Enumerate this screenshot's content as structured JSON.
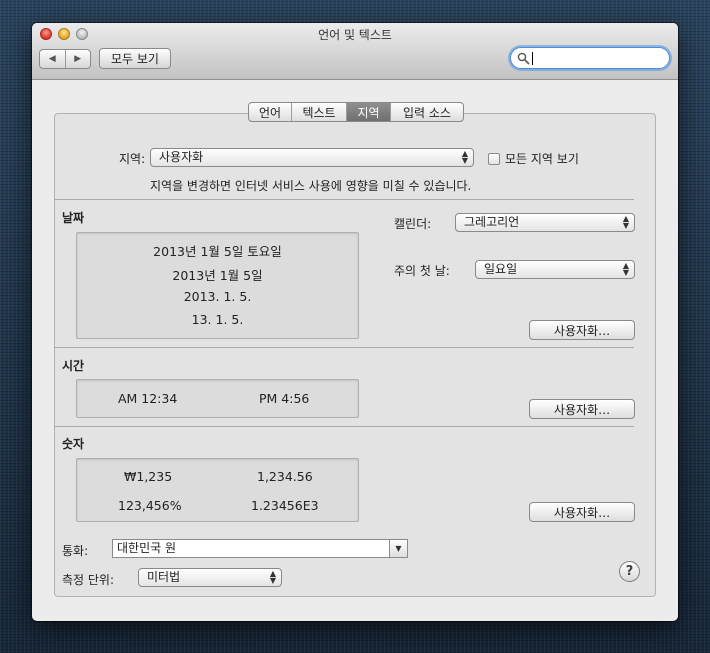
{
  "window": {
    "title": "언어 및 텍스트"
  },
  "toolbar": {
    "back_glyph": "◀",
    "forward_glyph": "▶",
    "show_all_label": "모두 보기",
    "search_value": "",
    "search_icon": "magnifier-icon"
  },
  "tabs": [
    {
      "label": "언어",
      "active": false
    },
    {
      "label": "텍스트",
      "active": false
    },
    {
      "label": "지역",
      "active": true
    },
    {
      "label": "입력 소스",
      "active": false
    }
  ],
  "region": {
    "label": "지역:",
    "value": "사용자화",
    "show_all_regions_label": "모든 지역 보기",
    "show_all_regions_checked": false,
    "note": "지역을 변경하면 인터넷 서비스 사용에 영향을 미칠 수 있습니다."
  },
  "dates": {
    "title": "날짜",
    "samples": [
      "2013년 1월 5일 토요일",
      "2013년 1월 5일",
      "2013. 1. 5.",
      "13. 1. 5."
    ],
    "calendar_label": "캘린더:",
    "calendar_value": "그레고리언",
    "first_day_label": "주의 첫 날:",
    "first_day_value": "일요일",
    "customize_label": "사용자화…"
  },
  "times": {
    "title": "시간",
    "samples": [
      "AM 12:34",
      "PM 4:56"
    ],
    "customize_label": "사용자화…"
  },
  "numbers": {
    "title": "숫자",
    "samples": [
      "₩1,235",
      "1,234.56",
      "123,456%",
      "1.23456E3"
    ],
    "customize_label": "사용자화…"
  },
  "currency": {
    "label": "통화:",
    "value": "대한민국 원"
  },
  "measurement": {
    "label": "측정 단위:",
    "value": "미터법"
  },
  "help": {
    "glyph": "?"
  }
}
